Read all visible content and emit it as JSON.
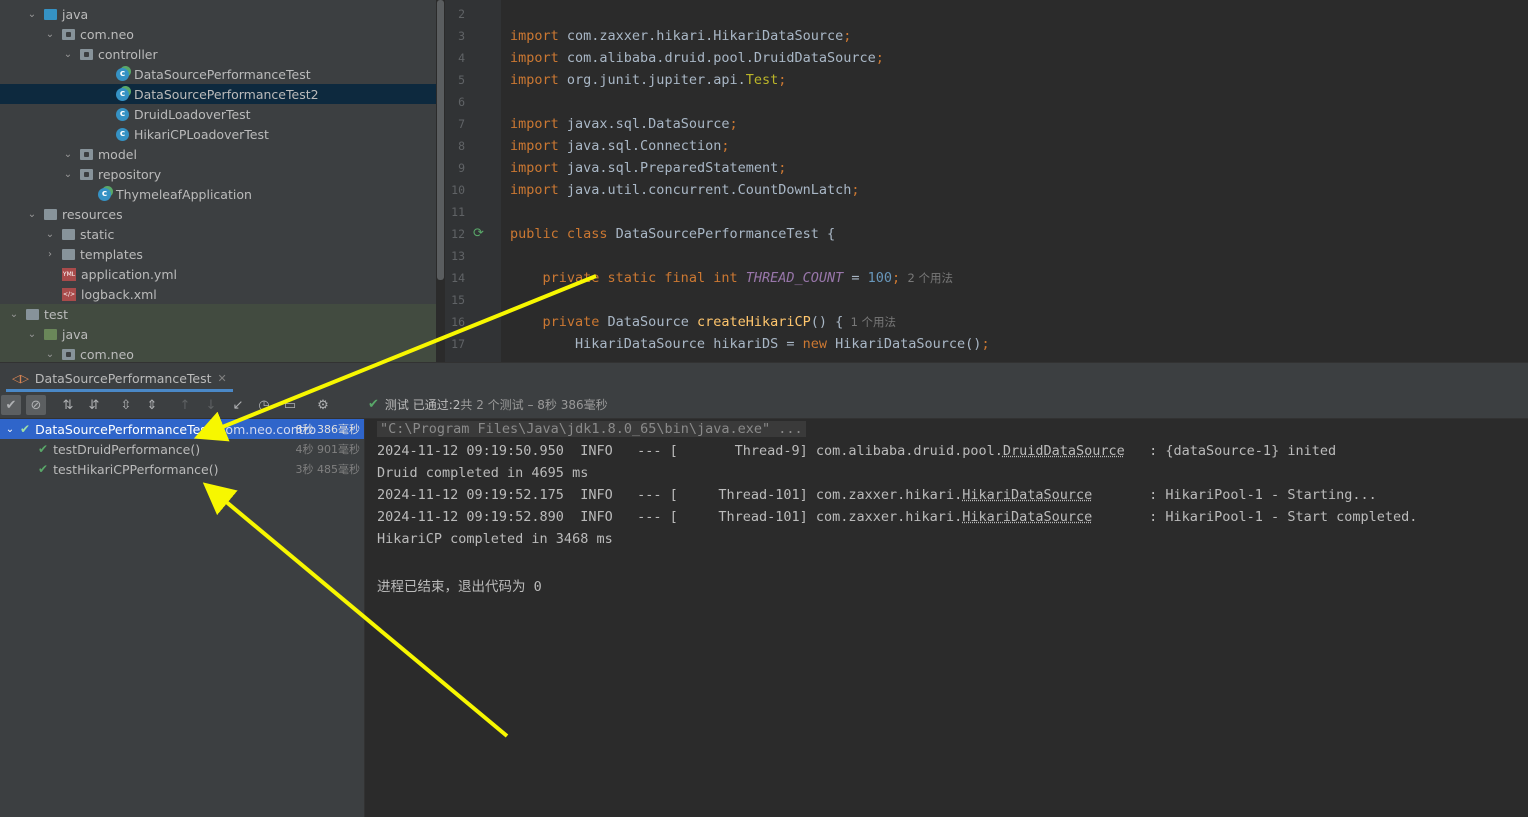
{
  "project_tree": [
    {
      "label": "java",
      "depth": 1,
      "chevron": "down",
      "icon": "folder-blue"
    },
    {
      "label": "com.neo",
      "depth": 2,
      "chevron": "down",
      "icon": "package"
    },
    {
      "label": "controller",
      "depth": 3,
      "chevron": "down",
      "icon": "package"
    },
    {
      "label": "DataSourcePerformanceTest",
      "depth": 5,
      "chevron": "",
      "icon": "class-run"
    },
    {
      "label": "DataSourcePerformanceTest2",
      "depth": 5,
      "chevron": "",
      "icon": "class-run",
      "selected": true
    },
    {
      "label": "DruidLoadoverTest",
      "depth": 5,
      "chevron": "",
      "icon": "class"
    },
    {
      "label": "HikariCPLoadoverTest",
      "depth": 5,
      "chevron": "",
      "icon": "class"
    },
    {
      "label": "model",
      "depth": 3,
      "chevron": "down",
      "icon": "package"
    },
    {
      "label": "repository",
      "depth": 3,
      "chevron": "down",
      "icon": "package"
    },
    {
      "label": "ThymeleafApplication",
      "depth": 4,
      "chevron": "",
      "icon": "class-run"
    },
    {
      "label": "resources",
      "depth": 1,
      "chevron": "down",
      "icon": "folder-res"
    },
    {
      "label": "static",
      "depth": 2,
      "chevron": "down",
      "icon": "folder-grey"
    },
    {
      "label": "templates",
      "depth": 2,
      "chevron": "right",
      "icon": "folder-grey"
    },
    {
      "label": "application.yml",
      "depth": 2,
      "chevron": "",
      "icon": "yml"
    },
    {
      "label": "logback.xml",
      "depth": 2,
      "chevron": "",
      "icon": "xml"
    },
    {
      "label": "test",
      "depth": 0,
      "chevron": "down",
      "icon": "folder-grey",
      "green": true
    },
    {
      "label": "java",
      "depth": 1,
      "chevron": "down",
      "icon": "folder-green",
      "green": true
    },
    {
      "label": "com.neo",
      "depth": 2,
      "chevron": "down",
      "icon": "package",
      "green": true
    }
  ],
  "editor": {
    "line_numbers": [
      "2",
      "3",
      "4",
      "5",
      "6",
      "7",
      "8",
      "9",
      "10",
      "11",
      "12",
      "13",
      "14",
      "15",
      "16",
      "17"
    ],
    "lines": [
      [],
      [
        [
          "kw",
          "import "
        ],
        [
          "cls",
          "com.zaxxer.hikari.HikariDataSource"
        ],
        [
          "kw",
          ";"
        ]
      ],
      [
        [
          "kw",
          "import "
        ],
        [
          "cls",
          "com.alibaba.druid.pool.DruidDataSource"
        ],
        [
          "kw",
          ";"
        ]
      ],
      [
        [
          "kw",
          "import "
        ],
        [
          "cls",
          "org.junit.jupiter.api."
        ],
        [
          "ann",
          "Test"
        ],
        [
          "kw",
          ";"
        ]
      ],
      [],
      [
        [
          "kw",
          "import "
        ],
        [
          "cls",
          "javax.sql.DataSource"
        ],
        [
          "kw",
          ";"
        ]
      ],
      [
        [
          "kw",
          "import "
        ],
        [
          "cls",
          "java.sql.Connection"
        ],
        [
          "kw",
          ";"
        ]
      ],
      [
        [
          "kw",
          "import "
        ],
        [
          "cls",
          "java.sql.PreparedStatement"
        ],
        [
          "kw",
          ";"
        ]
      ],
      [
        [
          "kw",
          "import "
        ],
        [
          "cls",
          "java.util.concurrent.CountDownLatch"
        ],
        [
          "kw",
          ";"
        ]
      ],
      [],
      [
        [
          "kw",
          "public class "
        ],
        [
          "cls",
          "DataSourcePerformanceTest {"
        ]
      ],
      [],
      [
        [
          "cls",
          "    "
        ],
        [
          "kw",
          "private static final int "
        ],
        [
          "fld",
          "THREAD_COUNT"
        ],
        [
          "cls",
          " = "
        ],
        [
          "num",
          "100"
        ],
        [
          "kw",
          ";"
        ],
        [
          "hint",
          "  2 个用法"
        ]
      ],
      [],
      [
        [
          "cls",
          "    "
        ],
        [
          "kw",
          "private "
        ],
        [
          "cls",
          "DataSource "
        ],
        [
          "fn",
          "createHikariCP"
        ],
        [
          "cls",
          "() {"
        ],
        [
          "hint",
          "  1 个用法"
        ]
      ],
      [
        [
          "cls",
          "        HikariDataSource hikariDS = "
        ],
        [
          "kw",
          "new "
        ],
        [
          "cls",
          "HikariDataSource()"
        ],
        [
          "kw",
          ";"
        ]
      ]
    ]
  },
  "run_tab": {
    "label": "DataSourcePerformanceTest"
  },
  "status": {
    "prefix": "测试 已通过: ",
    "count": "2",
    "suffix": "共 2 个测试 – 8秒 386毫秒"
  },
  "test_tree": [
    {
      "label": "DataSourcePerformanceTest",
      "suffix": "(com.neo.contro",
      "time": "8秒 386毫秒",
      "selected": true,
      "indent": 0
    },
    {
      "label": "testDruidPerformance()",
      "suffix": "",
      "time": "4秒 901毫秒",
      "selected": false,
      "indent": 1
    },
    {
      "label": "testHikariCPPerformance()",
      "suffix": "",
      "time": "3秒 485毫秒",
      "selected": false,
      "indent": 1
    }
  ],
  "console_lines": [
    {
      "type": "cmd",
      "parts": [
        [
          "",
          "\"C:\\Program Files\\Java\\jdk1.8.0_65\\bin\\java.exe\" ..."
        ]
      ]
    },
    {
      "type": "log",
      "parts": [
        [
          "",
          "2024-11-12 09:19:50.950  INFO   --- [       Thread-9] com.alibaba.druid.pool."
        ],
        [
          "ul",
          "DruidDataSource"
        ],
        [
          "",
          "   : {dataSource-1} inited"
        ]
      ]
    },
    {
      "type": "log",
      "parts": [
        [
          "",
          "Druid completed in 4695 ms"
        ]
      ]
    },
    {
      "type": "log",
      "parts": [
        [
          "",
          "2024-11-12 09:19:52.175  INFO   --- [     Thread-101] com.zaxxer.hikari."
        ],
        [
          "ul",
          "HikariDataSource"
        ],
        [
          "",
          "       : HikariPool-1 - Starting..."
        ]
      ]
    },
    {
      "type": "log",
      "parts": [
        [
          "",
          "2024-11-12 09:19:52.890  INFO   --- [     Thread-101] com.zaxxer.hikari."
        ],
        [
          "ul",
          "HikariDataSource"
        ],
        [
          "",
          "       : HikariPool-1 - Start completed."
        ]
      ]
    },
    {
      "type": "log",
      "parts": [
        [
          "",
          "HikariCP completed in 3468 ms"
        ]
      ]
    },
    {
      "type": "log",
      "parts": []
    },
    {
      "type": "log",
      "parts": [
        [
          "",
          "进程已结束，退出代码为 0"
        ]
      ]
    }
  ],
  "colors": {
    "arrow": "#f7f700",
    "selection": "#2f65ca",
    "pass": "#59a869"
  }
}
